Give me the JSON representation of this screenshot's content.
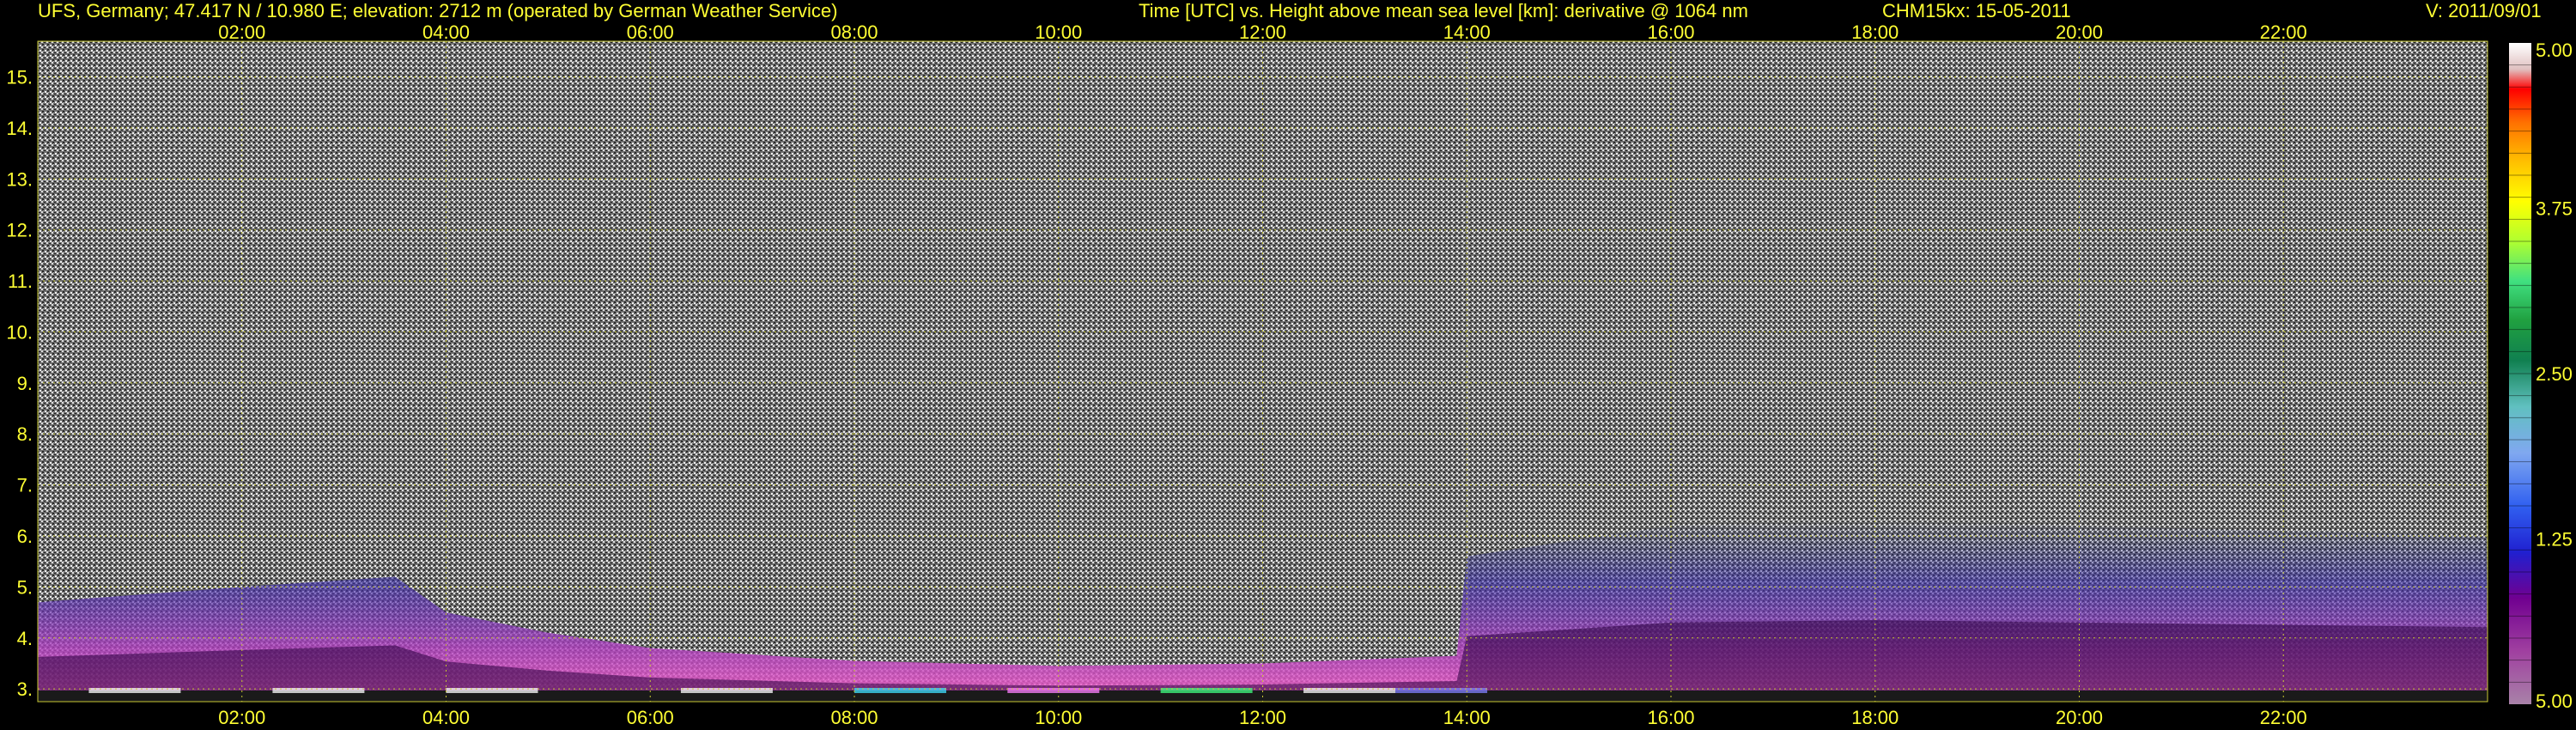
{
  "header": {
    "station": "UFS, Germany; 47.417 N / 10.980 E; elevation: 2712 m  (operated by German Weather Service)",
    "plot_title": "Time [UTC] vs. Height above mean sea level [km]: derivative @ 1064 nm",
    "instrument": "CHM15kx: 15-05-2011",
    "version": "V: 2011/09/01"
  },
  "colors": {
    "text": "#ffff33",
    "background": "#000000",
    "grid": "#c8c832"
  },
  "chart_data": {
    "type": "heatmap",
    "title": "Time [UTC] vs. Height above mean sea level [km]: derivative @ 1064 nm",
    "x_ticks": [
      "02:00",
      "04:00",
      "06:00",
      "08:00",
      "10:00",
      "12:00",
      "14:00",
      "16:00",
      "18:00",
      "20:00",
      "22:00"
    ],
    "x_tick_hours": [
      2,
      4,
      6,
      8,
      10,
      12,
      14,
      16,
      18,
      20,
      22
    ],
    "xlim": [
      0,
      24
    ],
    "y_ticks": [
      "3.",
      "4.",
      "5.",
      "6.",
      "7.",
      "8.",
      "9.",
      "10.",
      "11.",
      "12.",
      "13.",
      "14.",
      "15."
    ],
    "y_tick_values": [
      3,
      4,
      5,
      6,
      7,
      8,
      9,
      10,
      11,
      12,
      13,
      14,
      15
    ],
    "ylim": [
      2.75,
      15.7
    ],
    "grid": true,
    "colorbar": {
      "ticks": [
        "5.00",
        "3.75",
        "2.50",
        "1.25",
        "5.00"
      ],
      "tick_fractions": [
        1.0,
        0.75,
        0.5,
        0.25,
        0.0
      ],
      "placement": "right"
    },
    "layers": {
      "ground_layer_top_km": [
        [
          0,
          4.7
        ],
        [
          2,
          5.0
        ],
        [
          3.5,
          5.2
        ],
        [
          4,
          4.5
        ],
        [
          5,
          4.1
        ],
        [
          6,
          3.8
        ],
        [
          8,
          3.55
        ],
        [
          10,
          3.45
        ],
        [
          12,
          3.5
        ],
        [
          13.9,
          3.65
        ],
        [
          14,
          5.6
        ],
        [
          16,
          6.2
        ],
        [
          18,
          6.3
        ],
        [
          20,
          6.2
        ],
        [
          22,
          6.1
        ],
        [
          24,
          6.0
        ]
      ]
    }
  }
}
